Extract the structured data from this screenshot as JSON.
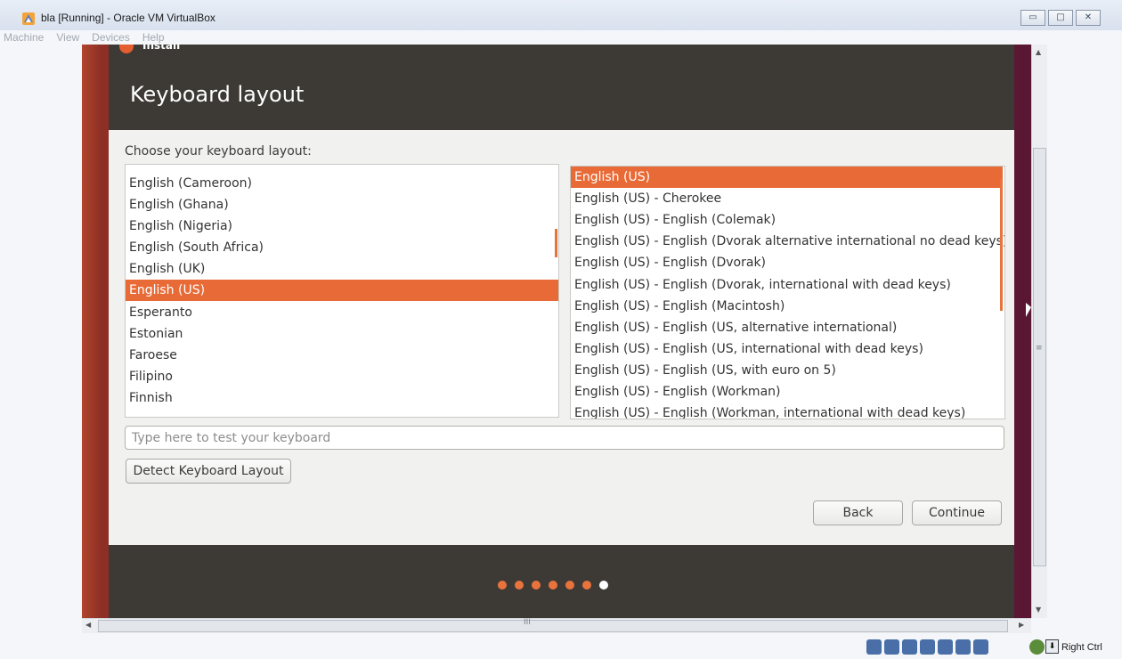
{
  "host_window": {
    "title": "bla [Running] - Oracle VM VirtualBox",
    "menu": [
      "Machine",
      "View",
      "Devices",
      "Help"
    ],
    "controls": [
      {
        "name": "minimize",
        "glyph": "▭"
      },
      {
        "name": "maximize",
        "glyph": "□"
      },
      {
        "name": "close",
        "glyph": "✕"
      }
    ],
    "hostkey_label": "Right Ctrl"
  },
  "installer": {
    "window_title": "Install",
    "page_title": "Keyboard layout",
    "choose_label": "Choose your keyboard layout:",
    "layouts": [
      "English (Cameroon)",
      "English (Ghana)",
      "English (Nigeria)",
      "English (South Africa)",
      "English (UK)",
      "English (US)",
      "Esperanto",
      "Estonian",
      "Faroese",
      "Filipino",
      "Finnish"
    ],
    "selected_layout": "English (US)",
    "variants": [
      "English (US)",
      "English (US) - Cherokee",
      "English (US) - English (Colemak)",
      "English (US) - English (Dvorak alternative international no dead keys)",
      "English (US) - English (Dvorak)",
      "English (US) - English (Dvorak, international with dead keys)",
      "English (US) - English (Macintosh)",
      "English (US) - English (US, alternative international)",
      "English (US) - English (US, international with dead keys)",
      "English (US) - English (US, with euro on 5)",
      "English (US) - English (Workman)",
      "English (US) - English (Workman, international with dead keys)"
    ],
    "selected_variant": "English (US)",
    "test_placeholder": "Type here to test your keyboard",
    "detect_button": "Detect Keyboard Layout",
    "back_button": "Back",
    "continue_button": "Continue",
    "progress": {
      "total_steps": 7,
      "current_step": 7
    }
  },
  "colors": {
    "accent": "#e86a36",
    "installer_dark": "#3d3a36",
    "desktop": "#6c1f2a"
  }
}
